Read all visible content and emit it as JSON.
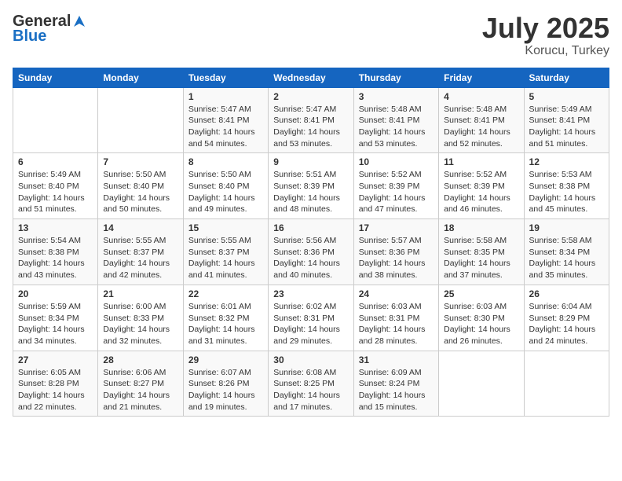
{
  "header": {
    "logo_general": "General",
    "logo_blue": "Blue",
    "title": "July 2025",
    "location": "Korucu, Turkey"
  },
  "weekdays": [
    "Sunday",
    "Monday",
    "Tuesday",
    "Wednesday",
    "Thursday",
    "Friday",
    "Saturday"
  ],
  "weeks": [
    [
      {
        "day": "",
        "info": ""
      },
      {
        "day": "",
        "info": ""
      },
      {
        "day": "1",
        "info": "Sunrise: 5:47 AM\nSunset: 8:41 PM\nDaylight: 14 hours\nand 54 minutes."
      },
      {
        "day": "2",
        "info": "Sunrise: 5:47 AM\nSunset: 8:41 PM\nDaylight: 14 hours\nand 53 minutes."
      },
      {
        "day": "3",
        "info": "Sunrise: 5:48 AM\nSunset: 8:41 PM\nDaylight: 14 hours\nand 53 minutes."
      },
      {
        "day": "4",
        "info": "Sunrise: 5:48 AM\nSunset: 8:41 PM\nDaylight: 14 hours\nand 52 minutes."
      },
      {
        "day": "5",
        "info": "Sunrise: 5:49 AM\nSunset: 8:41 PM\nDaylight: 14 hours\nand 51 minutes."
      }
    ],
    [
      {
        "day": "6",
        "info": "Sunrise: 5:49 AM\nSunset: 8:40 PM\nDaylight: 14 hours\nand 51 minutes."
      },
      {
        "day": "7",
        "info": "Sunrise: 5:50 AM\nSunset: 8:40 PM\nDaylight: 14 hours\nand 50 minutes."
      },
      {
        "day": "8",
        "info": "Sunrise: 5:50 AM\nSunset: 8:40 PM\nDaylight: 14 hours\nand 49 minutes."
      },
      {
        "day": "9",
        "info": "Sunrise: 5:51 AM\nSunset: 8:39 PM\nDaylight: 14 hours\nand 48 minutes."
      },
      {
        "day": "10",
        "info": "Sunrise: 5:52 AM\nSunset: 8:39 PM\nDaylight: 14 hours\nand 47 minutes."
      },
      {
        "day": "11",
        "info": "Sunrise: 5:52 AM\nSunset: 8:39 PM\nDaylight: 14 hours\nand 46 minutes."
      },
      {
        "day": "12",
        "info": "Sunrise: 5:53 AM\nSunset: 8:38 PM\nDaylight: 14 hours\nand 45 minutes."
      }
    ],
    [
      {
        "day": "13",
        "info": "Sunrise: 5:54 AM\nSunset: 8:38 PM\nDaylight: 14 hours\nand 43 minutes."
      },
      {
        "day": "14",
        "info": "Sunrise: 5:55 AM\nSunset: 8:37 PM\nDaylight: 14 hours\nand 42 minutes."
      },
      {
        "day": "15",
        "info": "Sunrise: 5:55 AM\nSunset: 8:37 PM\nDaylight: 14 hours\nand 41 minutes."
      },
      {
        "day": "16",
        "info": "Sunrise: 5:56 AM\nSunset: 8:36 PM\nDaylight: 14 hours\nand 40 minutes."
      },
      {
        "day": "17",
        "info": "Sunrise: 5:57 AM\nSunset: 8:36 PM\nDaylight: 14 hours\nand 38 minutes."
      },
      {
        "day": "18",
        "info": "Sunrise: 5:58 AM\nSunset: 8:35 PM\nDaylight: 14 hours\nand 37 minutes."
      },
      {
        "day": "19",
        "info": "Sunrise: 5:58 AM\nSunset: 8:34 PM\nDaylight: 14 hours\nand 35 minutes."
      }
    ],
    [
      {
        "day": "20",
        "info": "Sunrise: 5:59 AM\nSunset: 8:34 PM\nDaylight: 14 hours\nand 34 minutes."
      },
      {
        "day": "21",
        "info": "Sunrise: 6:00 AM\nSunset: 8:33 PM\nDaylight: 14 hours\nand 32 minutes."
      },
      {
        "day": "22",
        "info": "Sunrise: 6:01 AM\nSunset: 8:32 PM\nDaylight: 14 hours\nand 31 minutes."
      },
      {
        "day": "23",
        "info": "Sunrise: 6:02 AM\nSunset: 8:31 PM\nDaylight: 14 hours\nand 29 minutes."
      },
      {
        "day": "24",
        "info": "Sunrise: 6:03 AM\nSunset: 8:31 PM\nDaylight: 14 hours\nand 28 minutes."
      },
      {
        "day": "25",
        "info": "Sunrise: 6:03 AM\nSunset: 8:30 PM\nDaylight: 14 hours\nand 26 minutes."
      },
      {
        "day": "26",
        "info": "Sunrise: 6:04 AM\nSunset: 8:29 PM\nDaylight: 14 hours\nand 24 minutes."
      }
    ],
    [
      {
        "day": "27",
        "info": "Sunrise: 6:05 AM\nSunset: 8:28 PM\nDaylight: 14 hours\nand 22 minutes."
      },
      {
        "day": "28",
        "info": "Sunrise: 6:06 AM\nSunset: 8:27 PM\nDaylight: 14 hours\nand 21 minutes."
      },
      {
        "day": "29",
        "info": "Sunrise: 6:07 AM\nSunset: 8:26 PM\nDaylight: 14 hours\nand 19 minutes."
      },
      {
        "day": "30",
        "info": "Sunrise: 6:08 AM\nSunset: 8:25 PM\nDaylight: 14 hours\nand 17 minutes."
      },
      {
        "day": "31",
        "info": "Sunrise: 6:09 AM\nSunset: 8:24 PM\nDaylight: 14 hours\nand 15 minutes."
      },
      {
        "day": "",
        "info": ""
      },
      {
        "day": "",
        "info": ""
      }
    ]
  ]
}
